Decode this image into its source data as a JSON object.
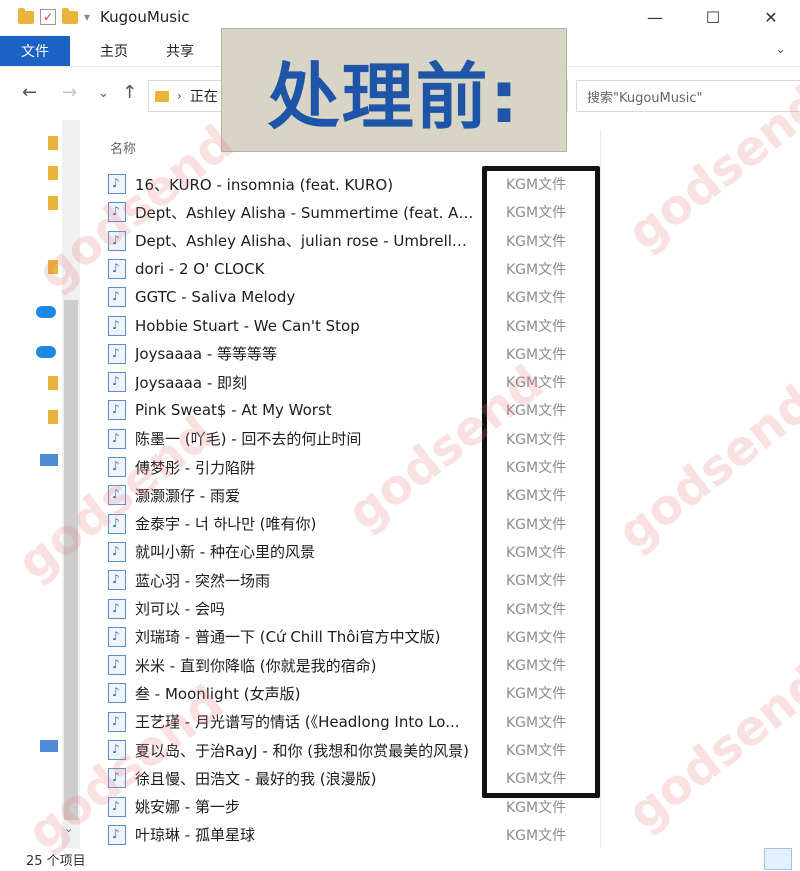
{
  "window": {
    "title": "KugouMusic",
    "minimize_glyph": "—",
    "maximize_glyph": "☐",
    "close_glyph": "✕"
  },
  "ribbon": {
    "file_tab": "文件",
    "tabs": [
      "主页",
      "共享"
    ],
    "expand_glyph": "⌄"
  },
  "address": {
    "back_glyph": "←",
    "forward_glyph": "→",
    "recent_glyph": "⌄",
    "up_glyph": "↑",
    "path_text": "正在",
    "search_placeholder": "搜索\"KugouMusic\""
  },
  "overlay": {
    "text": "处理前:"
  },
  "columns": {
    "name": "名称"
  },
  "files": [
    {
      "name": "16、KURO - insomnia (feat. KURO)",
      "type": "KGM文件"
    },
    {
      "name": "Dept、Ashley Alisha - Summertime (feat. As...",
      "type": "KGM文件"
    },
    {
      "name": "Dept、Ashley Alisha、julian rose - Umbrella ...",
      "type": "KGM文件"
    },
    {
      "name": "dori - 2 O' CLOCK",
      "type": "KGM文件"
    },
    {
      "name": "GGTC - Saliva Melody",
      "type": "KGM文件"
    },
    {
      "name": "Hobbie Stuart - We Can't Stop",
      "type": "KGM文件"
    },
    {
      "name": "Joysaaaa - 等等等等",
      "type": "KGM文件"
    },
    {
      "name": "Joysaaaa - 即刻",
      "type": "KGM文件"
    },
    {
      "name": "Pink Sweat$ - At My Worst",
      "type": "KGM文件"
    },
    {
      "name": "陈墨一 (吖毛) - 回不去的何止时间",
      "type": "KGM文件"
    },
    {
      "name": "傅梦彤 - 引力陷阱",
      "type": "KGM文件"
    },
    {
      "name": "灏灏灏仔 - 雨爱",
      "type": "KGM文件"
    },
    {
      "name": "金泰宇 - 너 하나만 (唯有你)",
      "type": "KGM文件"
    },
    {
      "name": "就叫小新 - 种在心里的风景",
      "type": "KGM文件"
    },
    {
      "name": "蓝心羽 - 突然一场雨",
      "type": "KGM文件"
    },
    {
      "name": "刘可以 - 会吗",
      "type": "KGM文件"
    },
    {
      "name": "刘瑞琦 - 普通一下 (Cứ Chill Thôi官方中文版)",
      "type": "KGM文件"
    },
    {
      "name": "米米 - 直到你降临 (你就是我的宿命)",
      "type": "KGM文件"
    },
    {
      "name": "叁 - Moonlight (女声版)",
      "type": "KGM文件"
    },
    {
      "name": "王艺瑾 - 月光谱写的情话 (《Headlong Into Lo...",
      "type": "KGM文件"
    },
    {
      "name": "夏以岛、于治RayJ - 和你 (我想和你赏最美的风景)",
      "type": "KGM文件"
    },
    {
      "name": "徐且慢、田浩文 - 最好的我 (浪漫版)",
      "type": "KGM文件"
    },
    {
      "name": "姚安娜 - 第一步",
      "type": "KGM文件"
    },
    {
      "name": "叶琼琳 - 孤单星球",
      "type": "KGM文件"
    }
  ],
  "status": {
    "item_count": "25 个项目"
  },
  "watermark": {
    "text": "godsend"
  },
  "colors": {
    "file_tab_bg": "#1a62c4",
    "overlay_text": "#1f55a8",
    "overlay_bg": "#d8d4c6",
    "type_text": "#8c8c8c"
  }
}
